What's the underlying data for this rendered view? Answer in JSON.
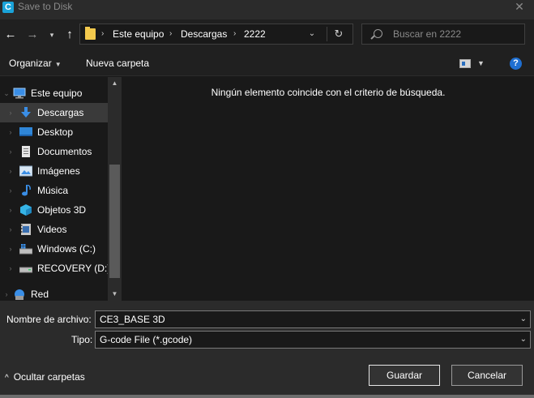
{
  "window": {
    "title": "Save to Disk",
    "app_logo_letter": "C",
    "close_glyph": "✕"
  },
  "nav": {
    "back_glyph": "←",
    "forward_glyph": "→",
    "recent_glyph": "▾",
    "up_glyph": "↑",
    "breadcrumbs": [
      "Este equipo",
      "Descargas",
      "2222"
    ],
    "separator": "›",
    "dropdown_glyph": "⌄",
    "refresh_glyph": "↻",
    "search_placeholder": "Buscar en 2222"
  },
  "toolbar": {
    "organize_label": "Organizar",
    "organize_arrow": "▼",
    "new_folder_label": "Nueva carpeta",
    "view_arrow": "▼",
    "help_glyph": "?"
  },
  "sidebar": {
    "items": [
      {
        "label": "Este equipo",
        "icon": "computer-icon",
        "level": 0,
        "expanded": true
      },
      {
        "label": "Descargas",
        "icon": "downloads-icon",
        "level": 1,
        "selected": true
      },
      {
        "label": "Desktop",
        "icon": "desktop-icon",
        "level": 1
      },
      {
        "label": "Documentos",
        "icon": "documents-icon",
        "level": 1
      },
      {
        "label": "Imágenes",
        "icon": "pictures-icon",
        "level": 1
      },
      {
        "label": "Música",
        "icon": "music-icon",
        "level": 1
      },
      {
        "label": "Objetos 3D",
        "icon": "3d-objects-icon",
        "level": 1
      },
      {
        "label": "Videos",
        "icon": "videos-icon",
        "level": 1
      },
      {
        "label": "Windows (C:)",
        "icon": "system-drive-icon",
        "level": 1
      },
      {
        "label": "RECOVERY (D:)",
        "icon": "drive-icon",
        "level": 1
      },
      {
        "label": "Red",
        "icon": "network-icon",
        "level": 0
      }
    ]
  },
  "content": {
    "empty_message": "Ningún elemento coincide con el criterio de búsqueda."
  },
  "form": {
    "filename_label": "Nombre de archivo:",
    "filename_value": "CE3_BASE 3D",
    "type_label": "Tipo:",
    "type_value": "G-code File (*.gcode)",
    "chevron": "⌄"
  },
  "footer": {
    "hide_folders_chev": "^",
    "hide_folders_label": "Ocultar carpetas",
    "save_label": "Guardar",
    "cancel_label": "Cancelar"
  },
  "colors": {
    "accent_blue": "#1f6fd1",
    "folder_yellow": "#f3c94d",
    "background": "#191919",
    "panel": "#2b2b2b"
  }
}
